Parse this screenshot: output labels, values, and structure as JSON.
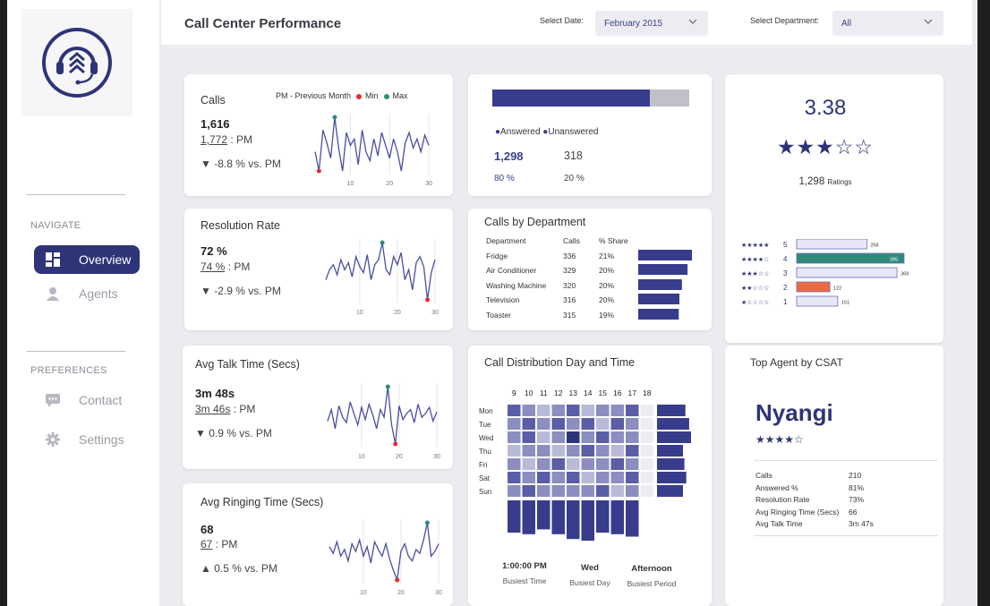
{
  "sidebar": {
    "navigate_heading": "NAVIGATE",
    "preferences_heading": "PREFERENCES",
    "nav": [
      {
        "label": "Overview",
        "icon": "dashboard-icon",
        "active": true
      },
      {
        "label": "Agents",
        "icon": "person-icon",
        "active": false
      }
    ],
    "prefs": [
      {
        "label": "Contact",
        "icon": "chat-icon"
      },
      {
        "label": "Settings",
        "icon": "gear-icon"
      }
    ]
  },
  "header": {
    "title": "Call Center Performance",
    "date_label": "Select Date:",
    "date_value": "February 2015",
    "dept_label": "Select Department:",
    "dept_value": "All"
  },
  "kpis": [
    {
      "title": "Calls",
      "value": "1,616",
      "pm_value": "1,772",
      "pm_suffix": " : PM",
      "delta": "-8.8 % vs. PM",
      "arrow": "▼",
      "series": [
        45,
        30,
        62,
        52,
        40,
        72,
        48,
        30,
        60,
        50,
        55,
        35,
        62,
        45,
        38,
        55,
        42,
        60,
        50,
        40,
        55,
        45,
        30,
        52,
        60,
        48,
        55,
        45,
        58,
        50
      ],
      "min_index": 1,
      "max_index": 5
    },
    {
      "title": "Resolution Rate",
      "value": "72 %",
      "pm_value": "74 %",
      "pm_suffix": " : PM",
      "delta": "-2.9 % vs. PM",
      "arrow": "▼",
      "series": [
        35,
        45,
        50,
        40,
        55,
        45,
        52,
        38,
        58,
        48,
        42,
        60,
        35,
        50,
        55,
        72,
        45,
        40,
        58,
        50,
        62,
        35,
        45,
        25,
        52,
        58,
        48,
        15,
        42,
        55
      ],
      "min_index": 27,
      "max_index": 15
    },
    {
      "title": "Avg Talk Time (Secs)",
      "value": "3m 48s",
      "pm_value": "3m 46s",
      "pm_suffix": " : PM",
      "delta": "0.9 % vs. PM",
      "arrow": "▼",
      "series": [
        40,
        55,
        30,
        60,
        45,
        38,
        65,
        50,
        35,
        58,
        42,
        62,
        48,
        30,
        55,
        45,
        85,
        35,
        10,
        60,
        42,
        50,
        55,
        38,
        62,
        45,
        50,
        58,
        40,
        52
      ],
      "min_index": 18,
      "max_index": 16
    },
    {
      "title": "Avg Ringing Time (Secs)",
      "value": "68",
      "pm_value": "67",
      "pm_suffix": " : PM",
      "delta": "0.5 % vs. PM",
      "arrow": "▲",
      "series": [
        55,
        48,
        60,
        45,
        52,
        40,
        58,
        50,
        62,
        45,
        55,
        38,
        60,
        52,
        45,
        58,
        42,
        30,
        20,
        50,
        58,
        45,
        40,
        52,
        48,
        62,
        80,
        45,
        50,
        58
      ],
      "min_index": 18,
      "max_index": 26
    }
  ],
  "spark_axis": [
    "10",
    "20",
    "30"
  ],
  "spark_legend": {
    "pm": "PM - Previous Month",
    "min": "Min",
    "max": "Max",
    "min_color": "#e03030",
    "max_color": "#2e8b7a"
  },
  "answered": {
    "answered_label": "Answered",
    "unanswered_label": "Unanswered",
    "answered_count": "1,298",
    "unanswered_count": "318",
    "answered_pct": "80 %",
    "unanswered_pct": "20 %",
    "answered_share": 0.8
  },
  "department": {
    "title": "Calls by Department",
    "headers": [
      "Department",
      "Calls",
      "% Share"
    ],
    "rows": [
      {
        "name": "Fridge",
        "calls": "336",
        "share": "21%",
        "value": 336
      },
      {
        "name": "Air Conditioner",
        "calls": "329",
        "share": "20%",
        "value": 329
      },
      {
        "name": "Washing Machine",
        "calls": "320",
        "share": "20%",
        "value": 320
      },
      {
        "name": "Television",
        "calls": "316",
        "share": "20%",
        "value": 316
      },
      {
        "name": "Toaster",
        "calls": "315",
        "share": "19%",
        "value": 315
      }
    ]
  },
  "distribution": {
    "title": "Call Distribution Day and Time",
    "hours": [
      "9",
      "10",
      "11",
      "12",
      "13",
      "14",
      "15",
      "16",
      "17",
      "18"
    ],
    "days": [
      "Mon",
      "Tue",
      "Wed",
      "Thu",
      "Fri",
      "Sat",
      "Sun"
    ],
    "matrix": [
      [
        4,
        3,
        2,
        3,
        4,
        2,
        3,
        3,
        4,
        1
      ],
      [
        3,
        4,
        3,
        4,
        3,
        4,
        2,
        4,
        3,
        1
      ],
      [
        3,
        4,
        2,
        3,
        5,
        3,
        4,
        3,
        3,
        1
      ],
      [
        2,
        3,
        3,
        2,
        3,
        4,
        3,
        2,
        4,
        1
      ],
      [
        3,
        2,
        3,
        4,
        2,
        3,
        3,
        4,
        3,
        1
      ],
      [
        4,
        3,
        4,
        3,
        4,
        2,
        3,
        3,
        4,
        1
      ],
      [
        3,
        4,
        3,
        3,
        3,
        3,
        4,
        2,
        3,
        1
      ]
    ],
    "day_totals": [
      60,
      68,
      72,
      55,
      58,
      62,
      55
    ],
    "hour_totals": [
      40,
      42,
      36,
      42,
      48,
      50,
      40,
      42,
      45,
      0
    ],
    "busiest_time": "1:00:00 PM",
    "busiest_time_label": "Busiest Time",
    "busiest_day": "Wed",
    "busiest_day_label": "Busiest Day",
    "busiest_period": "Afternoon",
    "busiest_period_label": "Busiest Period"
  },
  "rating": {
    "score": "3.38",
    "stars": "★★★☆☆",
    "count": "1,298",
    "count_label": "Ratings",
    "rows": [
      {
        "stars": "★★★★★",
        "level": "5",
        "value": "258",
        "count": 258,
        "color": "#e7e7f7"
      },
      {
        "stars": "★★★★☆",
        "level": "4",
        "value": "395",
        "count": 395,
        "color": "#2e8b7a"
      },
      {
        "stars": "★★★☆☆",
        "level": "3",
        "value": "369",
        "count": 369,
        "color": "#e7e7f7"
      },
      {
        "stars": "★★☆☆☆",
        "level": "2",
        "value": "122",
        "count": 122,
        "color": "#ea6a45"
      },
      {
        "stars": "★☆☆☆☆",
        "level": "1",
        "value": "151",
        "count": 151,
        "color": "#e7e7f7"
      }
    ]
  },
  "top_agent": {
    "title": "Top Agent by CSAT",
    "name": "Nyangi",
    "stars": "★★★★☆",
    "stats": [
      {
        "label": "Calls",
        "value": "210"
      },
      {
        "label": "Answered %",
        "value": "81%"
      },
      {
        "label": "Resolution Rate",
        "value": "73%"
      },
      {
        "label": "Avg Ringing Time (Secs)",
        "value": "66"
      },
      {
        "label": "Avg Talk Time",
        "value": "3m 47s"
      }
    ]
  },
  "colors": {
    "accent": "#2e3478",
    "bar": "#383c8c",
    "bar_light": "#c0c0c8",
    "max": "#2e8b7a",
    "min": "#e03030"
  }
}
